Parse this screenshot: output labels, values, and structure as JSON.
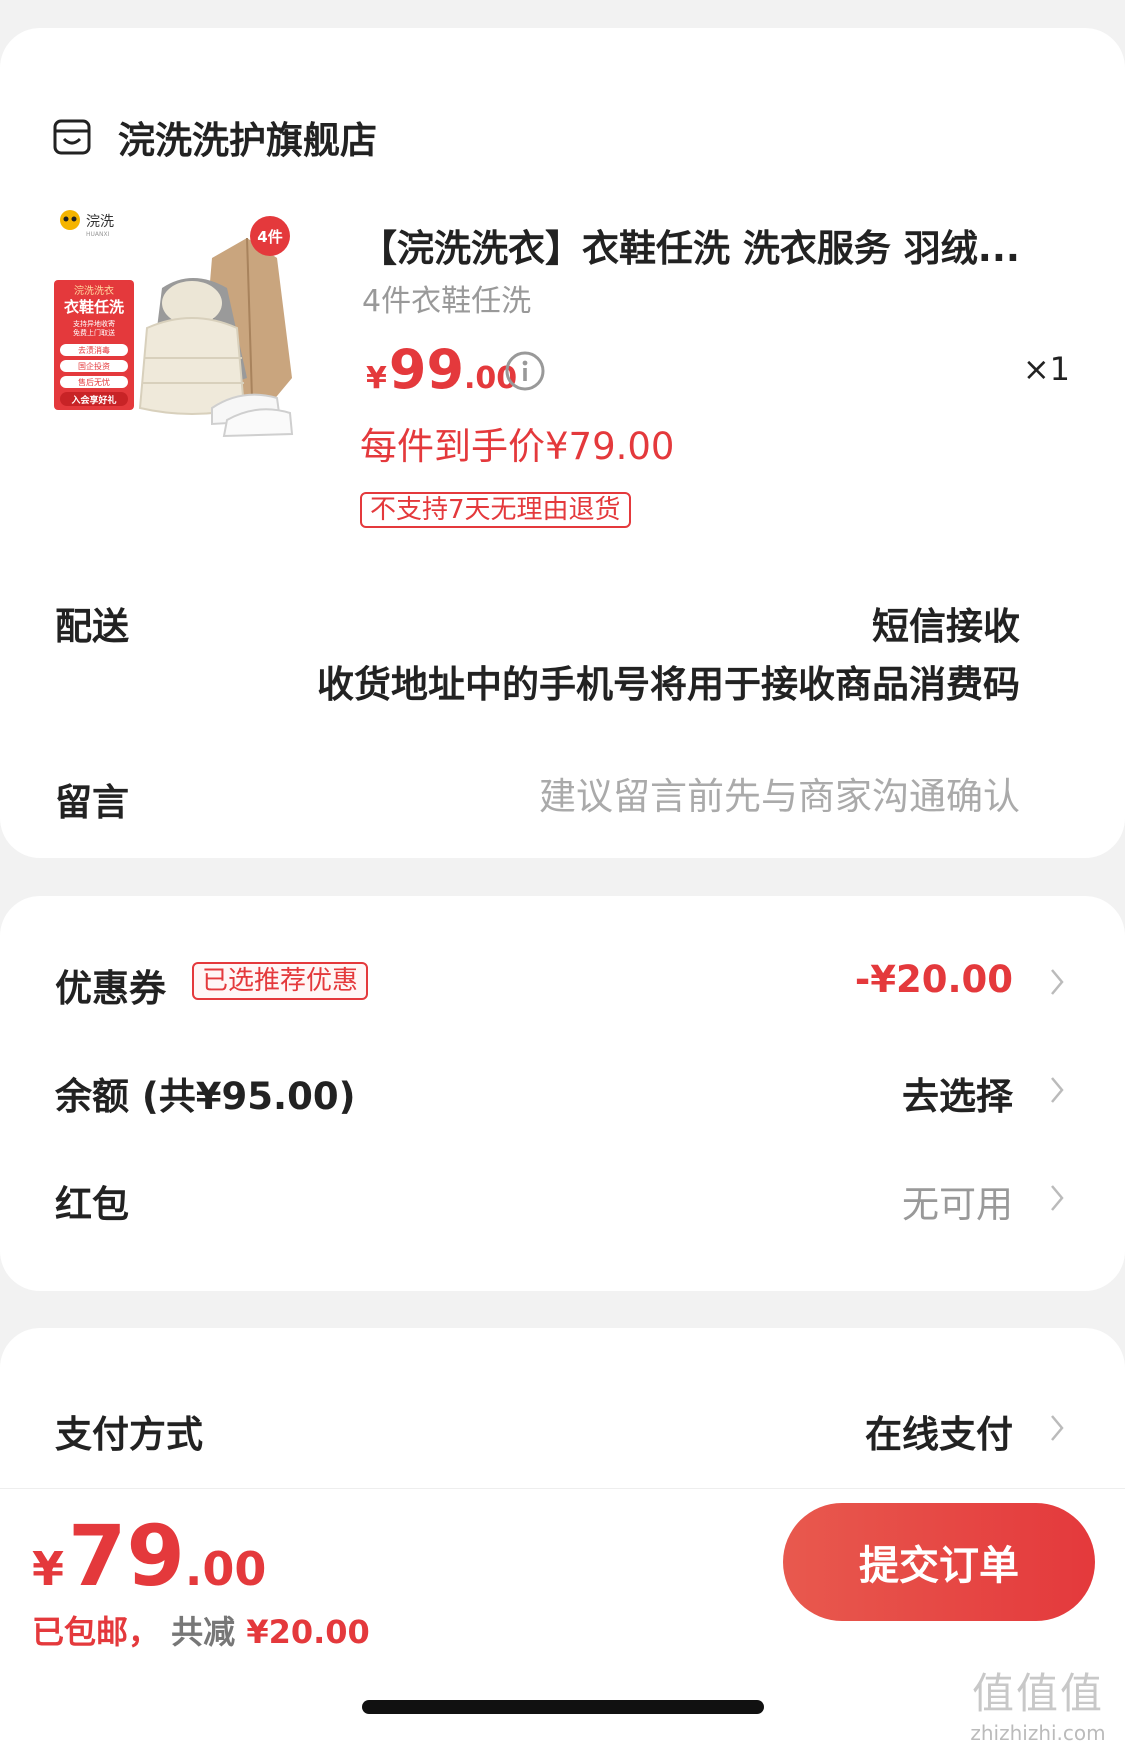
{
  "store": {
    "name": "浣洗洗护旗舰店",
    "icon": "store-icon"
  },
  "product": {
    "title": "【浣洗洗衣】衣鞋任洗 洗衣服务 羽绒...",
    "spec": "4件衣鞋任洗",
    "price_symbol": "¥",
    "price_int": "99",
    "price_dec": ".00",
    "quantity": "×1",
    "final_price": "每件到手价¥79.00",
    "return_tag": "不支持7天无理由退货",
    "thumb": {
      "brand": "浣洗",
      "brand_sub": "HUANXI",
      "badge": "4件",
      "banner_top": "浣洗洗衣",
      "banner_main": "衣鞋任洗",
      "banner_sub1": "支持异地收寄",
      "banner_sub2": "免费上门取送",
      "pills": [
        "去渍消毒",
        "国企投资",
        "售后无忧"
      ],
      "bottom": "入会享好礼"
    }
  },
  "delivery": {
    "label": "配送",
    "value": "短信接收",
    "note": "收货地址中的手机号将用于接收商品消费码"
  },
  "message": {
    "label": "留言",
    "placeholder": "建议留言前先与商家沟通确认"
  },
  "discounts": {
    "coupon": {
      "label": "优惠券",
      "tag": "已选推荐优惠",
      "value": "-¥20.00"
    },
    "balance": {
      "label": "余额 (共¥95.00)",
      "value": "去选择"
    },
    "redpacket": {
      "label": "红包",
      "value": "无可用"
    }
  },
  "payment": {
    "label": "支付方式",
    "value": "在线支付"
  },
  "footer": {
    "total_symbol": "¥",
    "total_int": "79",
    "total_dec": ".00",
    "shipping": "已包邮，",
    "reduced_label": "共减",
    "reduced_value": " ¥20.00",
    "submit": "提交订单"
  },
  "watermark": {
    "main": "值值值",
    "sub": "zhizhizhi.com"
  },
  "colors": {
    "accent": "#e4393c",
    "background": "#f2f2f2"
  }
}
